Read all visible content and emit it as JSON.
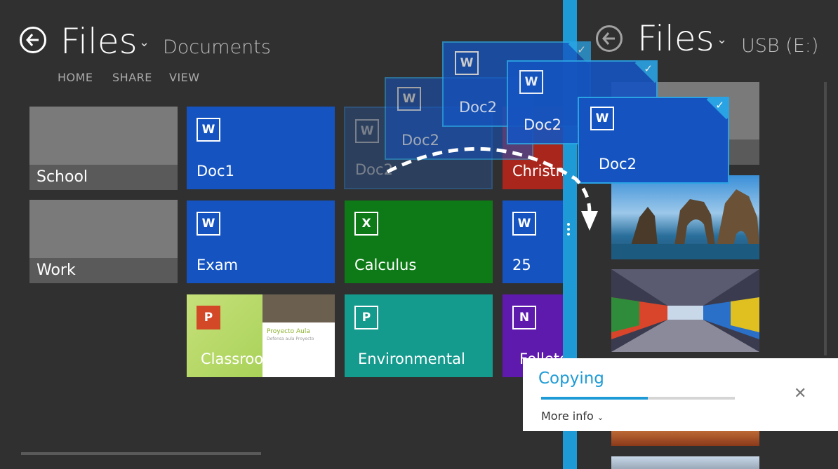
{
  "left_pane": {
    "title": "Files",
    "location": "Documents",
    "nav": [
      "HOME",
      "SHARE",
      "VIEW"
    ],
    "folders": [
      "School",
      "Work"
    ],
    "tiles": {
      "doc1": {
        "name": "Doc1",
        "badge": "W"
      },
      "doc2_ghost": {
        "name": "Doc2",
        "badge": "W"
      },
      "christmas": {
        "name": "Christm"
      },
      "exam": {
        "name": "Exam",
        "badge": "W"
      },
      "calculus": {
        "name": "Calculus",
        "badge": "X"
      },
      "num25": {
        "name": "25",
        "badge": "W"
      },
      "classroom": {
        "name": "Classroom",
        "badge": "P",
        "thumb_title": "Proyecto Aula",
        "thumb_sub": "Defensa aula Proyecto"
      },
      "environmental": {
        "name": "Environmental",
        "badge": "P"
      },
      "folleto": {
        "name": "Folleto",
        "badge": "N"
      }
    }
  },
  "right_pane": {
    "title": "Files",
    "location": "USB (E:)"
  },
  "drag_cards": [
    {
      "name": "Doc2",
      "badge": "W"
    },
    {
      "name": "Doc2",
      "badge": "W"
    },
    {
      "name": "Doc2",
      "badge": "W"
    },
    {
      "name": "Doc2",
      "badge": "W"
    }
  ],
  "toast": {
    "title": "Copying",
    "more_info": "More info",
    "progress": 0.55
  },
  "colors": {
    "accent": "#1e9bd6",
    "word_blue": "#1554c0",
    "excel_green": "#0e7a17",
    "ppt_teal": "#149b8e",
    "onenote_purple": "#5e19ad"
  }
}
